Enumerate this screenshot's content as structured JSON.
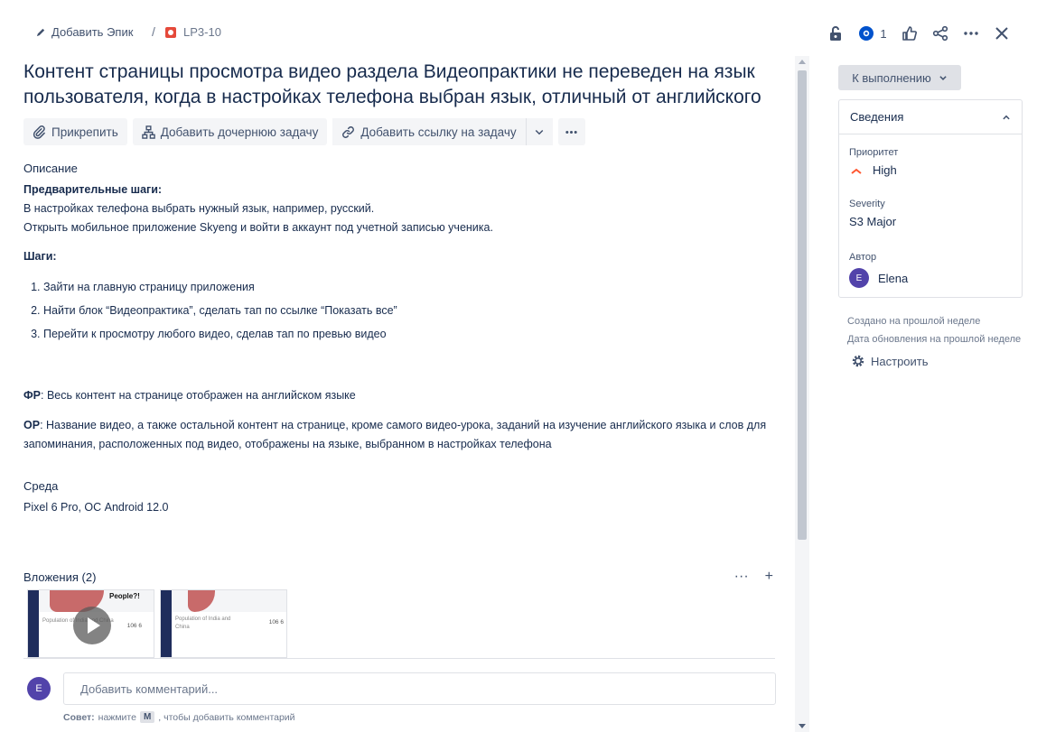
{
  "breadcrumb": {
    "add_epic": "Добавить Эпик",
    "separator": "/",
    "issue_key": "LP3-10"
  },
  "top_actions": {
    "watch_count": "1"
  },
  "issue": {
    "title": "Контент страницы просмотра видео раздела Видеопрактики не переведен на язык пользователя, когда в настройках телефона выбран язык, отличный от английского"
  },
  "toolbar": {
    "attach": "Прикрепить",
    "add_child": "Добавить дочернюю задачу",
    "add_link": "Добавить ссылку на задачу"
  },
  "description": {
    "label": "Описание",
    "preconditions_title": "Предварительные шаги:",
    "precondition_1": "В настройках телефона выбрать нужный язык, например, русский.",
    "precondition_2": "Открыть мобильное приложение Skyeng и войти в аккаунт под учетной записью ученика.",
    "steps_title": "Шаги:",
    "steps": [
      "Зайти на главную страницу приложения",
      "Найти блок “Видеопрактика”, сделать тап по ссылке “Показать все”",
      "Перейти к просмотру любого видео, сделав тап по превью видео"
    ],
    "fr_label": "ФР",
    "fr_text": ": Весь контент на странице отображен на английском языке",
    "or_label": "ОР",
    "or_text": ": Название видео, а также остальной контент на странице, кроме самого видео-урока, заданий на изучение английского языка и слов для запоминания, расположенных под видео, отображены на языке, выбранном в настройках телефона"
  },
  "environment": {
    "label": "Среда",
    "value": "Pixel 6 Pro, ОС Android 12.0"
  },
  "attachments": {
    "label": "Вложения (2)",
    "thumb1": {
      "title": "People?!",
      "caption": "Population of India and China",
      "likes": "106",
      "dislikes": "6"
    },
    "thumb2": {
      "caption": "Population of India and China",
      "likes": "106",
      "dislikes": "6"
    }
  },
  "comment": {
    "avatar_initial": "E",
    "placeholder": "Добавить комментарий...",
    "tip_label": "Совет:",
    "tip_pre": "нажмите",
    "tip_key": "M",
    "tip_post": ", чтобы добавить комментарий"
  },
  "sidebar": {
    "status": "К выполнению",
    "details_title": "Сведения",
    "priority_label": "Приоритет",
    "priority_value": "High",
    "severity_label": "Severity",
    "severity_value": "S3 Major",
    "author_label": "Автор",
    "author_initial": "E",
    "author_value": "Elena",
    "created": "Создано на прошлой неделе",
    "updated": "Дата обновления на прошлой неделе",
    "configure": "Настроить"
  },
  "colors": {
    "bug_red": "#e5493a",
    "avatar_purple": "#5243aa",
    "priority_orange": "#ff5630",
    "watch_blue": "#0052cc"
  }
}
